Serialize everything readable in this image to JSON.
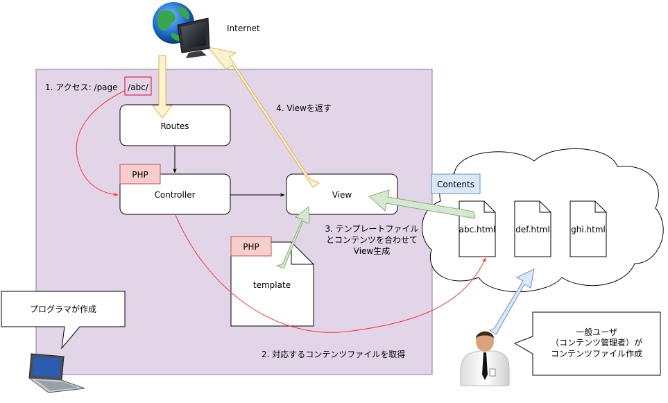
{
  "labels": {
    "internet": "Internet",
    "step1_prefix": "1. アクセス: /page",
    "step1_path": "/abc/",
    "step2": "2. 対応するコンテンツファイルを取得",
    "step3_line1": "3. テンプレートファイル",
    "step3_line2": "とコンテンツを合わせて",
    "step3_line3": "View生成",
    "step4": "4. Viewを返す"
  },
  "nodes": {
    "routes": "Routes",
    "controller": "Controller",
    "view": "View",
    "template": "template"
  },
  "tags": {
    "php_controller": "PHP",
    "php_template": "PHP",
    "contents": "Contents"
  },
  "files": [
    "abc.html",
    "def.html",
    "ghi.html"
  ],
  "callouts": {
    "programmer": "プログラマが作成",
    "user_line1": "一般ユーザ",
    "user_line2": "（コンテンツ管理者）が",
    "user_line3": "コンテンツファイル作成"
  },
  "colors": {
    "app_region": "#e1d5e7",
    "app_region_border": "#9673a6",
    "php_tag": "#f8cecc",
    "php_tag_border": "#b85450",
    "contents_tag": "#dae8fc",
    "contents_tag_border": "#6c8ebf",
    "arrow_yellow": "#fff2cc",
    "arrow_yellow_border": "#d6b656",
    "arrow_green": "#d5e8d4",
    "arrow_green_border": "#82b366",
    "arrow_blue": "#dae8fc",
    "arrow_blue_border": "#6c8ebf",
    "red_link": "#ff3333"
  },
  "icons": [
    "globe-monitor-icon",
    "laptop-icon",
    "user-person-icon"
  ]
}
